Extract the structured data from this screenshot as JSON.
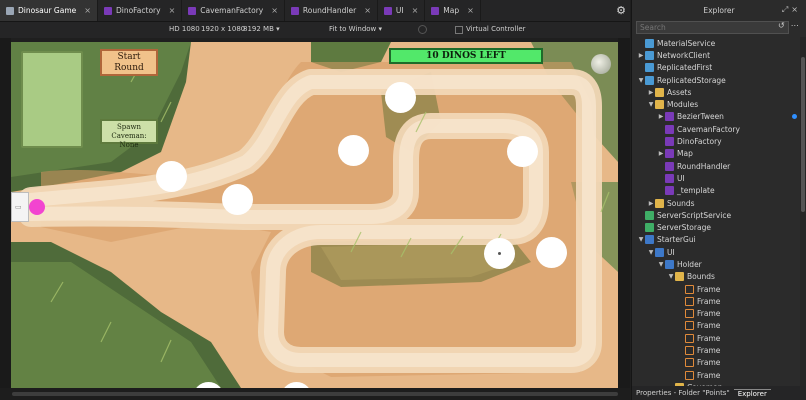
{
  "tabs": [
    {
      "label": "Dinosaur Game",
      "active": true,
      "icon": "place-icon"
    },
    {
      "label": "DinoFactory",
      "active": false,
      "icon": "module-script-icon"
    },
    {
      "label": "CavemanFactory",
      "active": false,
      "icon": "module-script-icon"
    },
    {
      "label": "RoundHandler",
      "active": false,
      "icon": "module-script-icon"
    },
    {
      "label": "UI",
      "active": false,
      "icon": "module-script-icon"
    },
    {
      "label": "Map",
      "active": false,
      "icon": "module-script-icon"
    }
  ],
  "viewport_toolbar": {
    "resolution_label": "HD 1080",
    "resolution_size": "1920 x 1080",
    "memory": "8192 MB",
    "fit_mode": "Fit to Window",
    "virtual_controller": "Virtual Controller"
  },
  "game": {
    "start_round": "Start Round",
    "spawn_caveman": "Spawn Caveman: None",
    "dinos_left": "10 DINOS LEFT"
  },
  "explorer": {
    "title": "Explorer",
    "search_placeholder": "Search",
    "items": [
      {
        "label": "MaterialService",
        "depth": 0,
        "arrow": "",
        "icon": "service"
      },
      {
        "label": "NetworkClient",
        "depth": 0,
        "arrow": "right",
        "icon": "service"
      },
      {
        "label": "ReplicatedFirst",
        "depth": 0,
        "arrow": "",
        "icon": "service"
      },
      {
        "label": "ReplicatedStorage",
        "depth": 0,
        "arrow": "down",
        "icon": "service"
      },
      {
        "label": "Assets",
        "depth": 1,
        "arrow": "right",
        "icon": "folder"
      },
      {
        "label": "Modules",
        "depth": 1,
        "arrow": "down",
        "icon": "folder"
      },
      {
        "label": "BezierTween",
        "depth": 2,
        "arrow": "right",
        "icon": "script",
        "modified": true
      },
      {
        "label": "CavemanFactory",
        "depth": 2,
        "arrow": "",
        "icon": "script"
      },
      {
        "label": "DinoFactory",
        "depth": 2,
        "arrow": "",
        "icon": "script"
      },
      {
        "label": "Map",
        "depth": 2,
        "arrow": "right",
        "icon": "script"
      },
      {
        "label": "RoundHandler",
        "depth": 2,
        "arrow": "",
        "icon": "script"
      },
      {
        "label": "UI",
        "depth": 2,
        "arrow": "",
        "icon": "script"
      },
      {
        "label": "_template",
        "depth": 2,
        "arrow": "",
        "icon": "script"
      },
      {
        "label": "Sounds",
        "depth": 1,
        "arrow": "right",
        "icon": "folder"
      },
      {
        "label": "ServerScriptService",
        "depth": 0,
        "arrow": "",
        "icon": "green"
      },
      {
        "label": "ServerStorage",
        "depth": 0,
        "arrow": "",
        "icon": "green"
      },
      {
        "label": "StarterGui",
        "depth": 0,
        "arrow": "down",
        "icon": "gui"
      },
      {
        "label": "UI",
        "depth": 1,
        "arrow": "down",
        "icon": "gui"
      },
      {
        "label": "Holder",
        "depth": 2,
        "arrow": "down",
        "icon": "gui"
      },
      {
        "label": "Bounds",
        "depth": 3,
        "arrow": "down",
        "icon": "folder"
      },
      {
        "label": "Frame",
        "depth": 4,
        "arrow": "",
        "icon": "frame"
      },
      {
        "label": "Frame",
        "depth": 4,
        "arrow": "",
        "icon": "frame"
      },
      {
        "label": "Frame",
        "depth": 4,
        "arrow": "",
        "icon": "frame"
      },
      {
        "label": "Frame",
        "depth": 4,
        "arrow": "",
        "icon": "frame"
      },
      {
        "label": "Frame",
        "depth": 4,
        "arrow": "",
        "icon": "frame"
      },
      {
        "label": "Frame",
        "depth": 4,
        "arrow": "",
        "icon": "frame"
      },
      {
        "label": "Frame",
        "depth": 4,
        "arrow": "",
        "icon": "frame"
      },
      {
        "label": "Frame",
        "depth": 4,
        "arrow": "",
        "icon": "frame"
      },
      {
        "label": "Caveman",
        "depth": 3,
        "arrow": "",
        "icon": "folder"
      }
    ],
    "footer_properties": "Properties - Folder \"Points\"",
    "footer_explorer": "Explorer"
  },
  "colors": {
    "module_script": "#7a3ab8",
    "folder": "#e0b44a",
    "modified_dot": "#2f8fff",
    "dinos_banner": "#52e86a"
  }
}
